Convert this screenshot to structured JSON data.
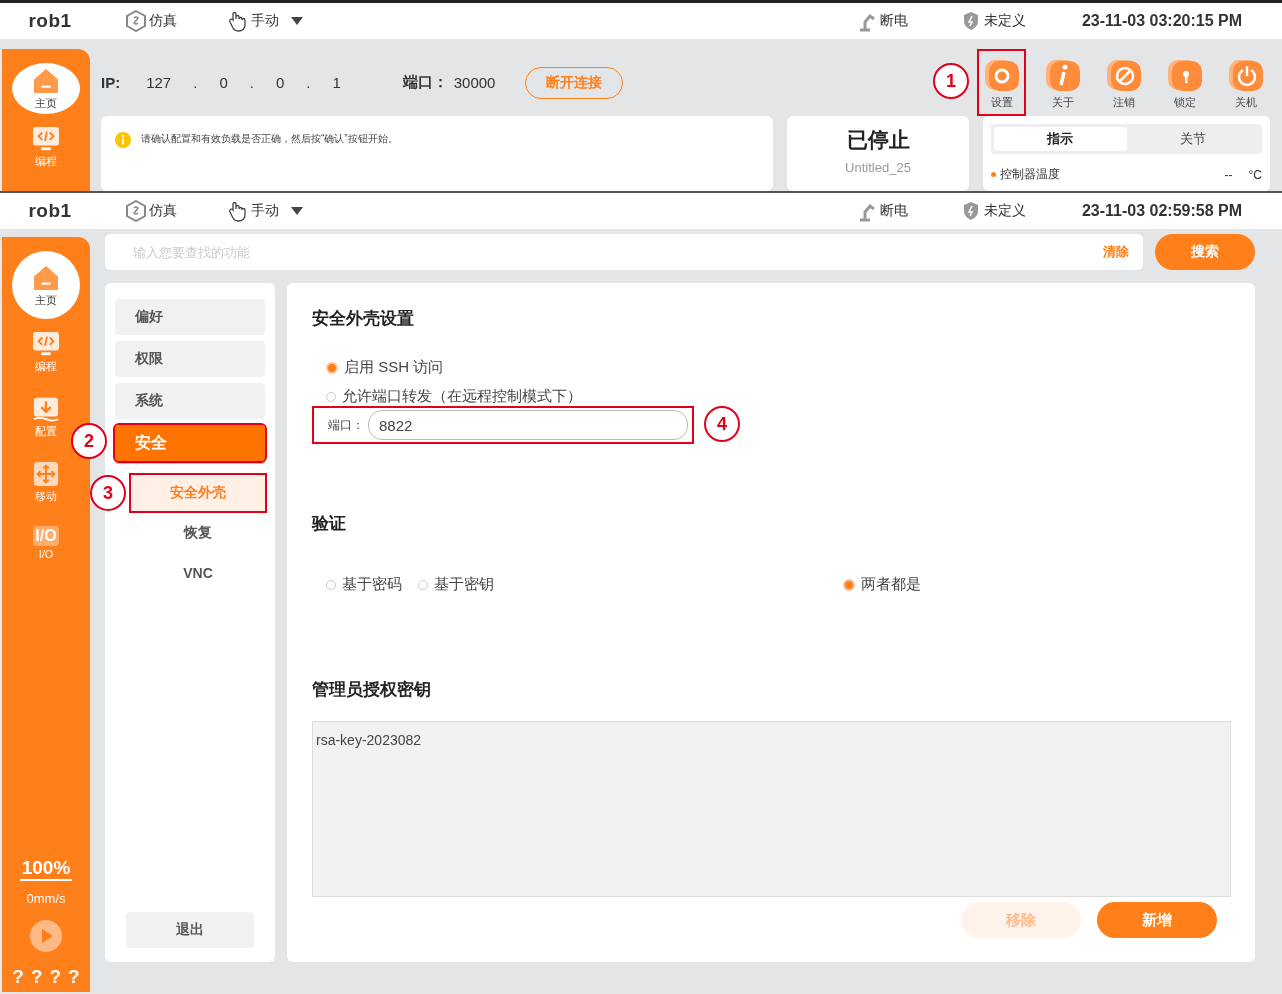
{
  "top_screen": {
    "status_bar": {
      "robot": "rob1",
      "sim": "仿真",
      "mode": "手动",
      "power": "断电",
      "safety": "未定义",
      "datetime": "23-11-03 03:20:15 PM"
    },
    "sidebar": {
      "items": [
        {
          "label": "主页",
          "kind": "home",
          "selected": true
        },
        {
          "label": "编程",
          "kind": "program",
          "selected": false
        }
      ]
    },
    "connection": {
      "ip_label": "IP:",
      "ip_parts": [
        "127",
        ".",
        "0",
        ".",
        "0",
        ".",
        "1"
      ],
      "port_label": "端口：",
      "port": "30000",
      "disconnect": "断开连接"
    },
    "toolbar": [
      {
        "label": "设置",
        "kind": "gear",
        "callout": "1"
      },
      {
        "label": "关于",
        "kind": "info"
      },
      {
        "label": "注销",
        "kind": "logout"
      },
      {
        "label": "锁定",
        "kind": "lock"
      },
      {
        "label": "关机",
        "kind": "power"
      }
    ],
    "notice": "请确认配置和有效负载是否正确，然后按“确认”按钮开始。",
    "program_status": {
      "state": "已停止",
      "name": "Untitled_25"
    },
    "tabs": [
      {
        "label": "指示",
        "selected": true
      },
      {
        "label": "关节",
        "selected": false
      }
    ],
    "readings": [
      {
        "label": "控制器温度",
        "value": "--",
        "unit": "°C"
      }
    ]
  },
  "bottom_screen": {
    "status_bar": {
      "robot": "rob1",
      "sim": "仿真",
      "mode": "手动",
      "power": "断电",
      "safety": "未定义",
      "datetime": "23-11-03 02:59:58 PM"
    },
    "sidebar": {
      "items": [
        {
          "label": "主页",
          "kind": "home",
          "selected": true
        },
        {
          "label": "编程",
          "kind": "program",
          "selected": false
        },
        {
          "label": "配置",
          "kind": "config",
          "selected": false
        },
        {
          "label": "移动",
          "kind": "move",
          "selected": false
        },
        {
          "label": "I/O",
          "kind": "io",
          "icon_text": "I/O",
          "selected": false
        }
      ],
      "speed": "100%",
      "velocity": "0mm/s",
      "footer": [
        "?",
        "?",
        "?",
        "?"
      ]
    },
    "search": {
      "placeholder": "输入您要查找的功能",
      "clear": "清除",
      "button": "搜索"
    },
    "nav": {
      "items": [
        {
          "label": "偏好",
          "selected": false
        },
        {
          "label": "权限",
          "selected": false
        },
        {
          "label": "系统",
          "selected": false
        },
        {
          "label": "安全",
          "selected": true,
          "callout": "2",
          "children": [
            {
              "label": "安全外壳",
              "selected": true,
              "callout": "3"
            },
            {
              "label": "恢复",
              "selected": false
            },
            {
              "label": "VNC",
              "selected": false
            }
          ]
        }
      ],
      "exit": "退出"
    },
    "content": {
      "title": "安全外壳设置",
      "options": [
        {
          "label": "启用 SSH 访问",
          "checked": true
        },
        {
          "label": "允许端口转发（在远程控制模式下）",
          "checked": false
        }
      ],
      "port": {
        "label": "端口：",
        "value": "8822",
        "callout": "4"
      },
      "auth_title": "验证",
      "auth_options": [
        {
          "label": "基于密码",
          "selected": false
        },
        {
          "label": "基于密钥",
          "selected": false
        },
        {
          "label": "两者都是",
          "selected": true
        }
      ],
      "keys_title": "管理员授权密钥",
      "keys": [
        "rsa-key-2023082"
      ],
      "buttons": [
        {
          "label": "移除",
          "disabled": true
        },
        {
          "label": "新增",
          "disabled": false
        }
      ]
    }
  }
}
